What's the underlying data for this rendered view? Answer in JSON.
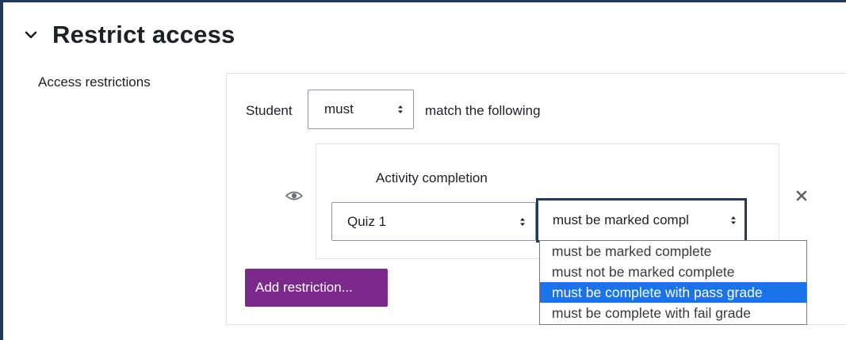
{
  "section": {
    "title": "Restrict access",
    "collapse_icon": "chevron-down-icon"
  },
  "field_label": "Access restrictions",
  "restriction_set": {
    "student_label": "Student",
    "must_select_value": "must",
    "match_label": "match the following"
  },
  "condition": {
    "type_label": "Activity completion",
    "visibility_icon": "eye-icon",
    "activity_value": "Quiz 1",
    "completion_value": "must be marked compl",
    "delete_icon": "close-icon"
  },
  "add_button_label": "Add restriction...",
  "dropdown_options": [
    {
      "label": "must be marked complete",
      "selected": false
    },
    {
      "label": "must not be marked complete",
      "selected": false
    },
    {
      "label": "must be complete with pass grade",
      "selected": true
    },
    {
      "label": "must be complete with fail grade",
      "selected": false
    }
  ],
  "colors": {
    "frame": "#1f3a5a",
    "button_bg": "#7b2a8c",
    "highlight": "#1a73e8"
  }
}
